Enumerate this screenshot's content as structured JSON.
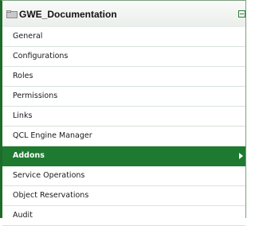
{
  "header": {
    "title": "GWE_Documentation",
    "folder_icon": "folder-icon",
    "collapse_icon": "collapse-minus-icon"
  },
  "menu": {
    "items": [
      {
        "label": "General",
        "active": false
      },
      {
        "label": "Configurations",
        "active": false
      },
      {
        "label": "Roles",
        "active": false
      },
      {
        "label": "Permissions",
        "active": false
      },
      {
        "label": "Links",
        "active": false
      },
      {
        "label": "QCL Engine Manager",
        "active": false
      },
      {
        "label": "Addons",
        "active": true
      },
      {
        "label": "Service Operations",
        "active": false
      },
      {
        "label": "Object Reservations",
        "active": false
      },
      {
        "label": "Audit",
        "active": false
      }
    ]
  },
  "colors": {
    "accent_green": "#1e7a30",
    "border_green": "#1e6b2a"
  }
}
